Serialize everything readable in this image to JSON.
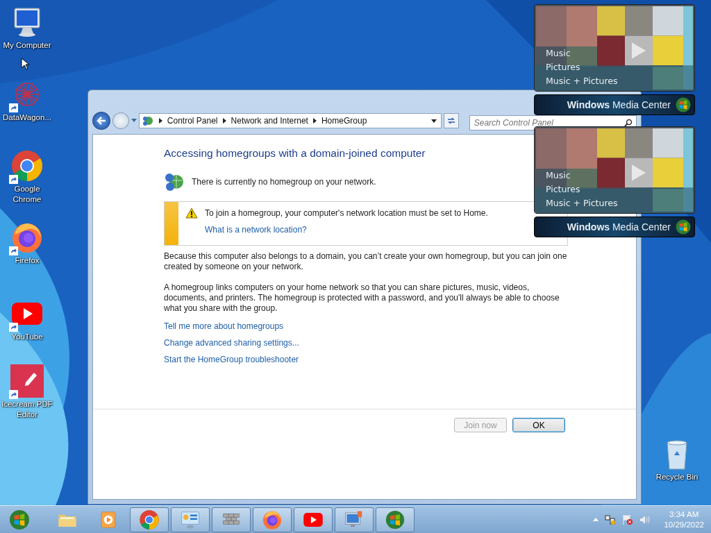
{
  "desktop_icons": [
    {
      "kind": "computer",
      "label": "My Computer",
      "shortcut": false
    },
    {
      "kind": "wagon",
      "label": "DataWagon...",
      "shortcut": true
    },
    {
      "kind": "chrome",
      "label": "Google Chrome",
      "shortcut": true
    },
    {
      "kind": "firefox",
      "label": "Firefox",
      "shortcut": true
    },
    {
      "kind": "youtube",
      "label": "YouTube",
      "shortcut": true
    },
    {
      "kind": "pdf",
      "label": "Icecream PDF Editor",
      "shortcut": true
    },
    {
      "kind": "recycle",
      "label": "Recycle Bin",
      "shortcut": false
    }
  ],
  "window": {
    "breadcrumb": [
      "Control Panel",
      "Network and Internet",
      "HomeGroup"
    ],
    "search": {
      "placeholder": "Search Control Panel"
    },
    "heading": "Accessing homegroups with a domain-joined computer",
    "status": "There is currently no homegroup on your network.",
    "warning": {
      "text": "To join a homegroup, your computer's network location must be set to Home.",
      "link": "What is a network location?"
    },
    "paragraphs": [
      "Because this computer also belongs to a domain, you can’t create your own homegroup, but you can join one created by someone on your network.",
      "A homegroup links computers on your home network so that you can share pictures, music, videos, documents, and printers. The homegroup is protected with a password, and you'll always be able to choose what you share with the group."
    ],
    "links": [
      "Tell me more about homegroups",
      "Change advanced sharing settings...",
      "Start the HomeGroup troubleshooter"
    ],
    "buttons": [
      {
        "label": "Join now",
        "disabled": true
      },
      {
        "label": "OK",
        "disabled": false
      }
    ]
  },
  "gadgets": [
    {
      "menu": [
        "Music",
        "Pictures",
        "Music + Pictures"
      ],
      "title": "**Windows** Media Center"
    },
    {
      "menu": [
        "Music",
        "Pictures",
        "Music + Pictures"
      ],
      "title": "**Windows** Media Center"
    }
  ],
  "taskbar": {
    "items": [
      {
        "kind": "explorer",
        "running": false
      },
      {
        "kind": "player",
        "running": false
      },
      {
        "kind": "chrome",
        "running": true
      },
      {
        "kind": "control",
        "running": true
      },
      {
        "kind": "wall",
        "running": true
      },
      {
        "kind": "firefox",
        "running": true
      },
      {
        "kind": "youtube",
        "running": true
      },
      {
        "kind": "remote",
        "running": true
      },
      {
        "kind": "windows",
        "running": true
      }
    ],
    "time": "3:34 AM",
    "date": "10/29/2022"
  }
}
